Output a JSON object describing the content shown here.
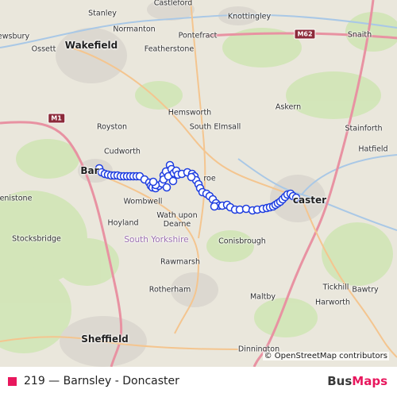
{
  "map": {
    "places": [
      {
        "id": "castleford",
        "label": "Castleford",
        "kind": "town"
      },
      {
        "id": "stanley",
        "label": "Stanley",
        "kind": "town"
      },
      {
        "id": "knottingley",
        "label": "Knottingley",
        "kind": "town"
      },
      {
        "id": "ewsbury",
        "label": "ewsbury",
        "kind": "town"
      },
      {
        "id": "normanton",
        "label": "Normanton",
        "kind": "town"
      },
      {
        "id": "snaith",
        "label": "Snaith",
        "kind": "town"
      },
      {
        "id": "wakefield",
        "label": "Wakefield",
        "kind": "city"
      },
      {
        "id": "pontefract",
        "label": "Pontefract",
        "kind": "town"
      },
      {
        "id": "ossett",
        "label": "Ossett",
        "kind": "town"
      },
      {
        "id": "featherstone",
        "label": "Featherstone",
        "kind": "town"
      },
      {
        "id": "askern",
        "label": "Askern",
        "kind": "town"
      },
      {
        "id": "hemsworth",
        "label": "Hemsworth",
        "kind": "town"
      },
      {
        "id": "royston",
        "label": "Royston",
        "kind": "town"
      },
      {
        "id": "south-elmsall",
        "label": "South Elmsall",
        "kind": "town"
      },
      {
        "id": "stainforth",
        "label": "Stainforth",
        "kind": "town"
      },
      {
        "id": "cudworth",
        "label": "Cudworth",
        "kind": "town"
      },
      {
        "id": "hatfield",
        "label": "Hatfield",
        "kind": "town"
      },
      {
        "id": "barnsley",
        "label": "Bar",
        "kind": "city"
      },
      {
        "id": "penistone",
        "label": "enistone",
        "kind": "town"
      },
      {
        "id": "mexborough",
        "label": "roe",
        "kind": "town"
      },
      {
        "id": "doncaster",
        "label": "caster",
        "kind": "city"
      },
      {
        "id": "wombwell",
        "label": "Wombwell",
        "kind": "town"
      },
      {
        "id": "hoyland",
        "label": "Hoyland",
        "kind": "town"
      },
      {
        "id": "wath",
        "label": "Wath upon\nDearne",
        "kind": "town"
      },
      {
        "id": "conisbrough",
        "label": "Conisbrough",
        "kind": "town"
      },
      {
        "id": "stocksbridge",
        "label": "Stocksbridge",
        "kind": "town"
      },
      {
        "id": "south-yorkshire",
        "label": "South Yorkshire",
        "kind": "region"
      },
      {
        "id": "rawmarsh",
        "label": "Rawmarsh",
        "kind": "town"
      },
      {
        "id": "tickhill",
        "label": "Tickhill",
        "kind": "town"
      },
      {
        "id": "rotherham",
        "label": "Rotherham",
        "kind": "town"
      },
      {
        "id": "bawtry",
        "label": "Bawtry",
        "kind": "town"
      },
      {
        "id": "maltby",
        "label": "Maltby",
        "kind": "town"
      },
      {
        "id": "harworth",
        "label": "Harworth",
        "kind": "town"
      },
      {
        "id": "sheffield",
        "label": "Sheffield",
        "kind": "city"
      },
      {
        "id": "dinnington",
        "label": "Dinnington",
        "kind": "town"
      }
    ],
    "road_shields": [
      {
        "id": "m62",
        "label": "M62"
      },
      {
        "id": "m1",
        "label": "M1"
      }
    ],
    "attribution": "© OpenStreetMap contributors"
  },
  "footer": {
    "route_label": "219 — Barnsley - Doncaster",
    "route_color": "#e8175d",
    "logo_bus": "Bus",
    "logo_maps": "Maps",
    "logo_bus_color": "#3a3a3a",
    "logo_maps_color": "#e8175d"
  },
  "route": {
    "stop_color": "#1f3ee0",
    "stop_fill": "#ffffff"
  }
}
